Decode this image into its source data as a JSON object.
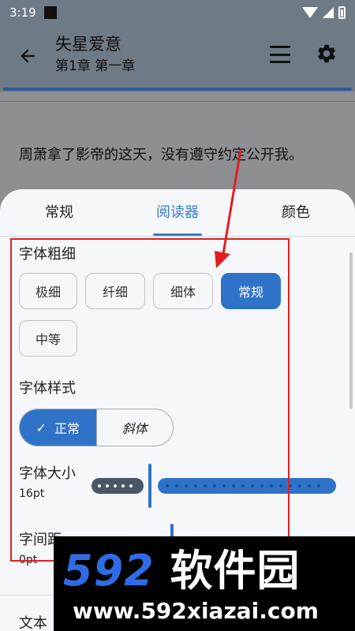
{
  "status_bar": {
    "time": "3:19"
  },
  "app_bar": {
    "title": "失星爱意",
    "subtitle": "第1章 第一章"
  },
  "reader": {
    "text": "周萧拿了影帝的这天，没有遵守约定公开我。"
  },
  "sheet": {
    "tabs": [
      {
        "label": "常规"
      },
      {
        "label": "阅读器"
      },
      {
        "label": "颜色"
      }
    ],
    "active_tab": "阅读器",
    "font_weight": {
      "label": "字体粗细",
      "options": [
        "极细",
        "纤细",
        "细体",
        "常规",
        "中等"
      ],
      "selected": "常规"
    },
    "font_style": {
      "label": "字体样式",
      "options": [
        "正常",
        "斜体"
      ],
      "selected": "正常"
    },
    "font_size": {
      "label": "字体大小",
      "value": "16pt"
    },
    "letter_spacing": {
      "label": "字间距",
      "value": "0pt"
    },
    "bottom_item": "文本"
  },
  "watermark": {
    "logo_num": "592",
    "logo_text": "软件园",
    "url": "www.592xiazai.com"
  },
  "colors": {
    "accent": "#2f73c8",
    "annotation": "#e02020",
    "app_bar": "#6f7a87"
  }
}
